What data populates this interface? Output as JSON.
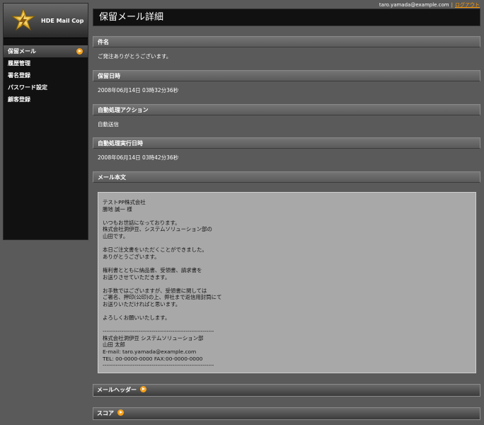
{
  "header": {
    "user_email": "taro.yamada@example.com",
    "logout_label": "ログアウト",
    "separator": "|"
  },
  "sidebar": {
    "logo_text": "HDE Mail Cop",
    "items": [
      {
        "label": "保留メール",
        "active": true
      },
      {
        "label": "履歴管理"
      },
      {
        "label": "署名登録"
      },
      {
        "label": "パスワード設定"
      },
      {
        "label": "顧客登録"
      }
    ]
  },
  "page": {
    "title": "保留メール詳細"
  },
  "sections": {
    "subject": {
      "label": "件名",
      "value": "ご発注ありがとうございます。"
    },
    "held_at": {
      "label": "保留日時",
      "value": "2008年06月14日 03時32分36秒"
    },
    "action": {
      "label": "自動処理アクション",
      "value": "自動送信"
    },
    "action_at": {
      "label": "自動処理実行日時",
      "value": "2008年06月14日 03時42分36秒"
    },
    "body": {
      "label": "メール本文"
    }
  },
  "mail_body": [
    "テストPP株式会社",
    "勝地 誠一 様",
    "",
    "いつもお世話になっております。",
    "株式会社洞伊豆、システムソリューション部の",
    "山田です。",
    "",
    "本日ご注文書をいただくことができました。",
    "ありがとうございます。",
    "",
    "権利書とともに納品書、受領書、請求書を",
    "お送りさせていただきます。",
    "",
    "お手数ではございますが、受領書に関しては",
    "ご署名、押印(公印)の上、弊社まで返信用封筒にて",
    "お送りいただければと思います。",
    "",
    "よろしくお願いいたします。",
    "",
    "-----------------------------------------------------------",
    "株式会社洞伊豆 システムソリューション部",
    "山田 太郎",
    "E-mail: taro.yamada@example.com",
    "TEL: 00-0000-0000 FAX:00-0000-0000",
    "-----------------------------------------------------------"
  ],
  "collapsibles": {
    "headers_label": "メールヘッダー",
    "score_label": "スコア"
  },
  "colors": {
    "background": "#5a5a5a",
    "accent": "#f7a11a",
    "link": "#ff9900"
  }
}
